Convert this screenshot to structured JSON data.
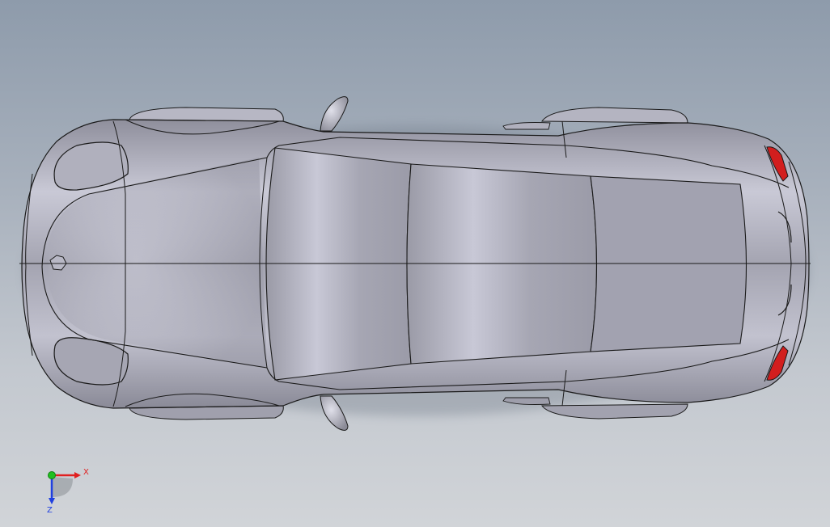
{
  "viewport": {
    "background_top": "#8e9bab",
    "background_bottom": "#d1d4d8"
  },
  "model": {
    "body_color": "#a9a9b6",
    "edge_color": "#1a1a1a",
    "taillight_color": "#d21e1e"
  },
  "triad": {
    "x_label": "X",
    "z_label": "Z",
    "x_color": "#e02020",
    "y_color": "#20c020",
    "z_color": "#2040e0"
  }
}
